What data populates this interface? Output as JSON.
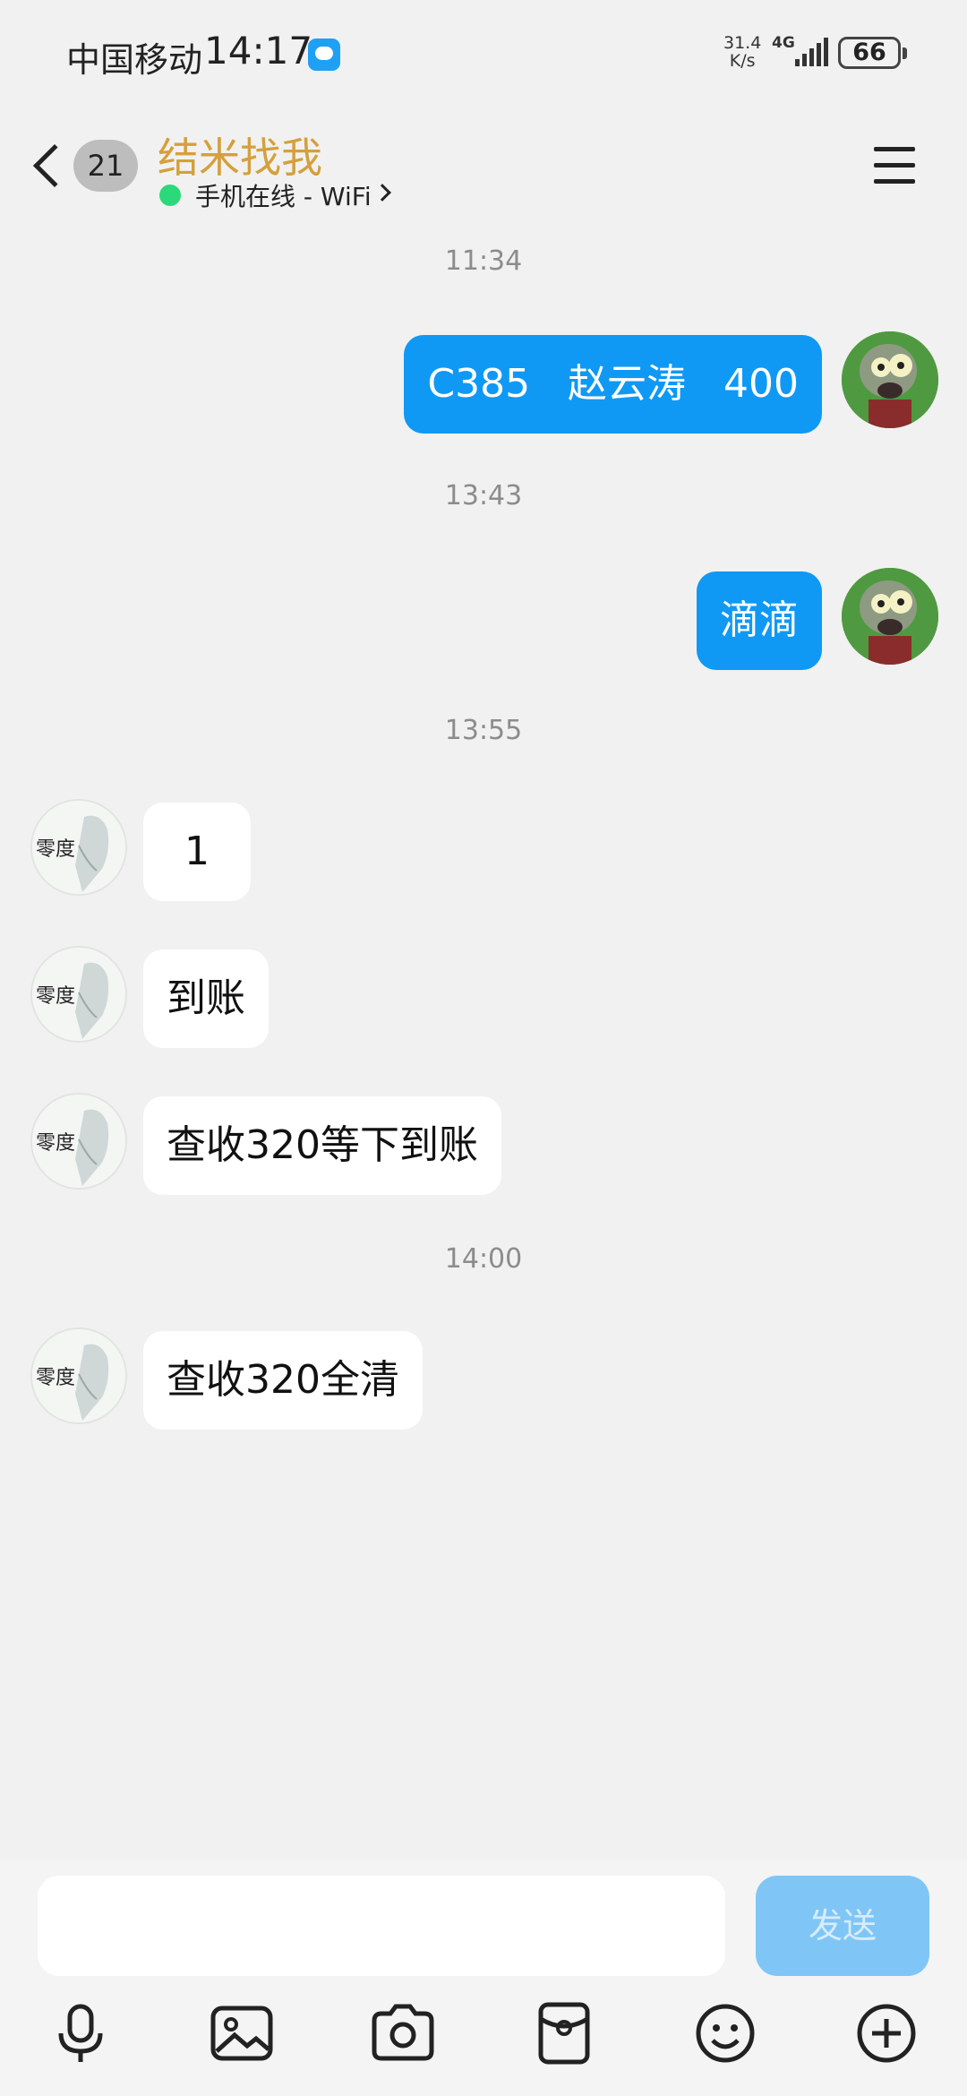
{
  "status_bar": {
    "carrier": "中国移动",
    "time": "14:17",
    "net_speed_value": "31.4",
    "net_speed_unit": "K/s",
    "network": "4G",
    "battery": "66"
  },
  "header": {
    "unread_count": "21",
    "contact_name": "结米找我",
    "online_status": "手机在线 - WiFi"
  },
  "messages": [
    {
      "type": "time",
      "text": "11:34"
    },
    {
      "type": "out",
      "text": "C385   赵云涛   400"
    },
    {
      "type": "time",
      "text": "13:43"
    },
    {
      "type": "out",
      "text": "滴滴"
    },
    {
      "type": "time",
      "text": "13:55"
    },
    {
      "type": "in",
      "text": "1"
    },
    {
      "type": "in",
      "text": "到账"
    },
    {
      "type": "in",
      "text": "查收320等下到账"
    },
    {
      "type": "time",
      "text": "14:00"
    },
    {
      "type": "in",
      "text": "查收320全清"
    }
  ],
  "avatar_other_text": "零度",
  "input": {
    "placeholder": "",
    "send_label": "发送"
  },
  "toolbar": {
    "icons": [
      "microphone-icon",
      "image-icon",
      "camera-icon",
      "red-packet-icon",
      "emoji-icon",
      "plus-icon"
    ]
  }
}
